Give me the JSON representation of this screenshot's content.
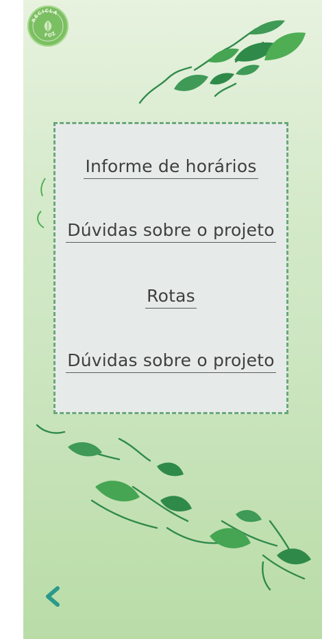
{
  "logo": {
    "text_top": "RECICLA",
    "text_bottom": "FOZ"
  },
  "menu": {
    "items": [
      {
        "label": "Informe de horários"
      },
      {
        "label": "Dúvidas sobre o projeto"
      },
      {
        "label": "Rotas"
      },
      {
        "label": "Dúvidas sobre o projeto"
      }
    ]
  },
  "nav": {
    "back_icon": "chevron-left-icon"
  },
  "colors": {
    "accent": "#2a9a8b",
    "leaf_dark": "#2f8a4a",
    "leaf_light": "#4fae54",
    "panel_border": "#6aa777",
    "panel_bg": "#e6ebea"
  }
}
